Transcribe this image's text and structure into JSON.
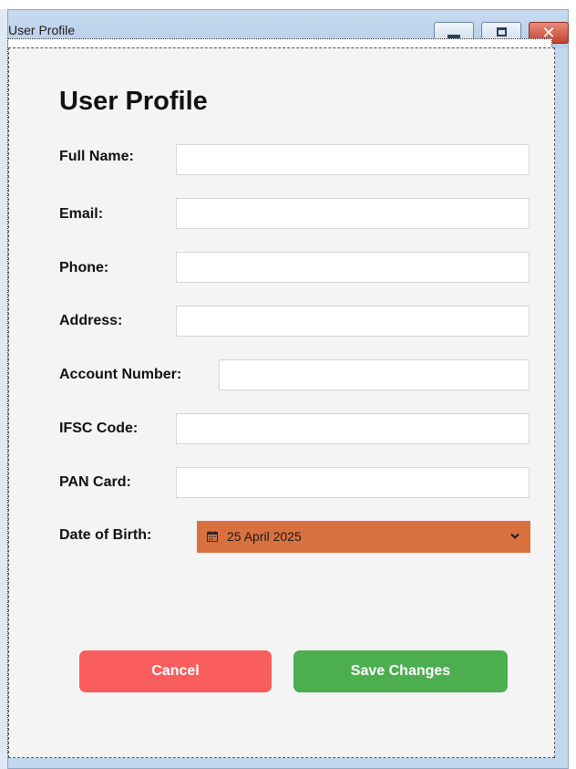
{
  "window": {
    "title": "User Profile",
    "minimize_label": "Minimize",
    "maximize_label": "Maximize",
    "close_label": "Close"
  },
  "form": {
    "heading": "User Profile",
    "fields": [
      {
        "label": "Full Name:",
        "value": "",
        "placeholder": ""
      },
      {
        "label": "Email:",
        "value": "",
        "placeholder": ""
      },
      {
        "label": "Phone:",
        "value": "",
        "placeholder": ""
      },
      {
        "label": "Address:",
        "value": "",
        "placeholder": ""
      },
      {
        "label": "Account Number:",
        "value": "",
        "placeholder": ""
      },
      {
        "label": "IFSC Code:",
        "value": "",
        "placeholder": ""
      },
      {
        "label": "PAN Card:",
        "value": "",
        "placeholder": ""
      }
    ],
    "dob": {
      "label": "Date of Birth:",
      "value": "25 April 2025",
      "icon": "calendar-icon",
      "dropdown_icon": "chevron-down-icon",
      "background_color": "#d9713f"
    }
  },
  "buttons": {
    "cancel_label": "Cancel",
    "save_label": "Save Changes",
    "cancel_color": "#fa5d5d",
    "save_color": "#4cae4f"
  }
}
